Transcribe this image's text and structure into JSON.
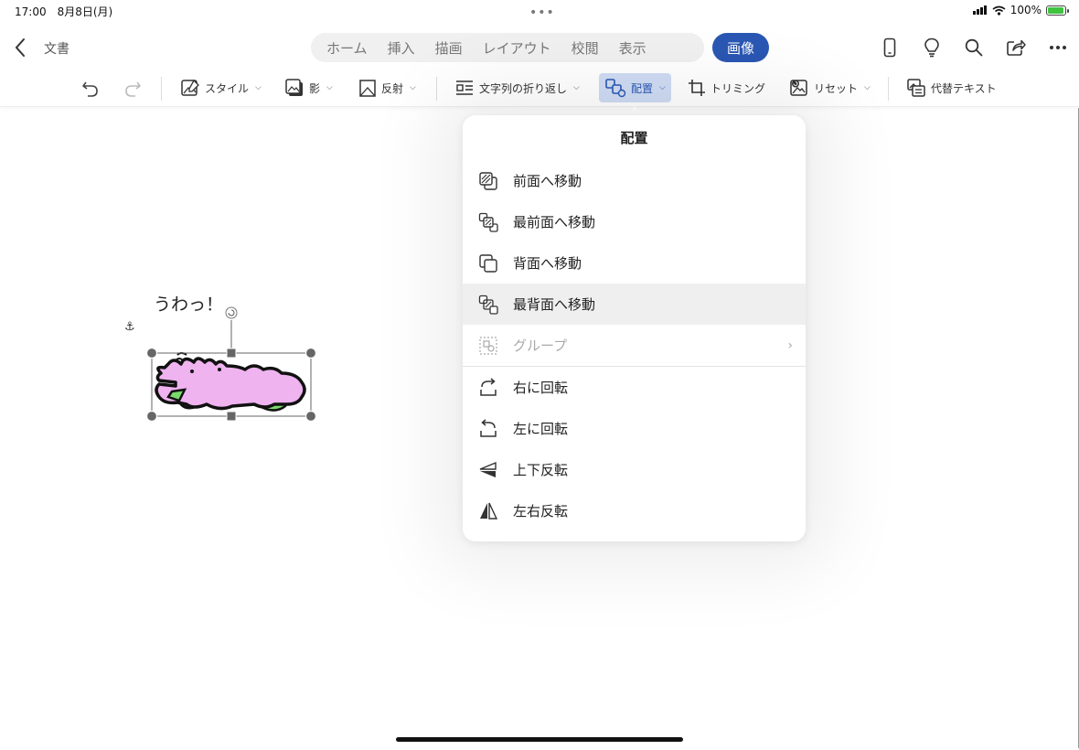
{
  "status_bar": {
    "time_date": "17:00　8月8日(月)",
    "battery": "100%",
    "battery_level": 1.0
  },
  "header": {
    "back_icon": "chevron-left-icon",
    "doc_title": "文書",
    "tabs": [
      {
        "label": "ホーム"
      },
      {
        "label": "挿入"
      },
      {
        "label": "描画"
      },
      {
        "label": "レイアウト"
      },
      {
        "label": "校閲"
      },
      {
        "label": "表示"
      }
    ],
    "active_tab": "画像",
    "accent_color": "#2a57b3",
    "right_icons": [
      "phone-layout-icon",
      "lightbulb-icon",
      "search-icon",
      "share-icon",
      "more-icon"
    ]
  },
  "ribbon": {
    "undo_icon": "undo-icon",
    "redo_icon": "redo-icon",
    "style": "スタイル",
    "shadow": "影",
    "reflection": "反射",
    "wrap_text": "文字列の折り返し",
    "arrange": "配置",
    "crop": "トリミング",
    "reset": "リセット",
    "alt_text": "代替テキスト"
  },
  "canvas": {
    "text": "うわっ！",
    "image_name": "pink-crocodile-image"
  },
  "popover": {
    "title": "配置",
    "items": [
      {
        "label": "前面へ移動",
        "icon": "bring-forward-icon"
      },
      {
        "label": "最前面へ移動",
        "icon": "bring-to-front-icon"
      },
      {
        "label": "背面へ移動",
        "icon": "send-backward-icon"
      },
      {
        "label": "最背面へ移動",
        "icon": "send-to-back-icon"
      },
      {
        "label": "グループ",
        "icon": "group-icon"
      },
      {
        "label": "右に回転",
        "icon": "rotate-right-icon"
      },
      {
        "label": "左に回転",
        "icon": "rotate-left-icon"
      },
      {
        "label": "上下反転",
        "icon": "flip-vertical-icon"
      },
      {
        "label": "左右反転",
        "icon": "flip-horizontal-icon"
      }
    ]
  }
}
